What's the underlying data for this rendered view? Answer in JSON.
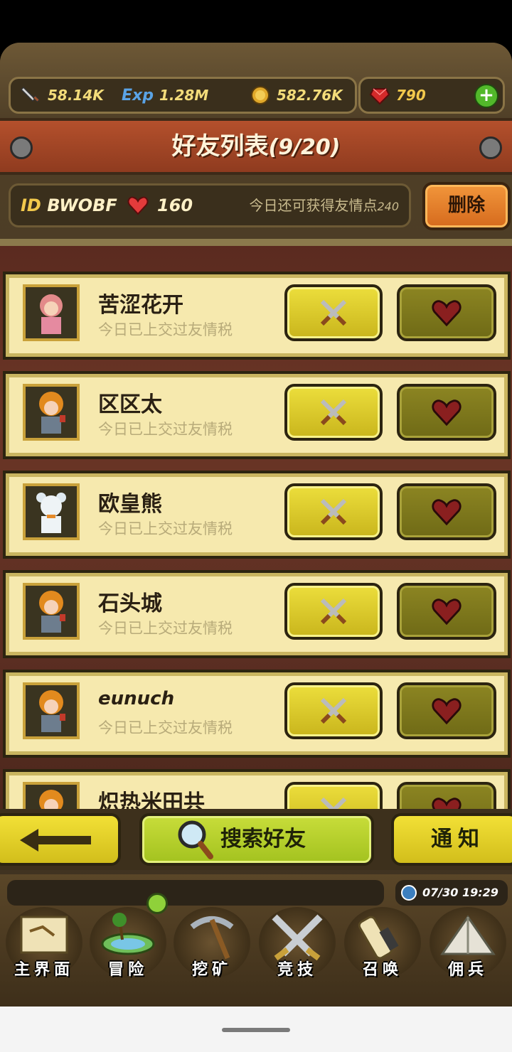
{
  "currency": {
    "attack": "58.14K",
    "exp_label": "Exp",
    "exp": "1.28M",
    "gold": "582.76K",
    "gems": "790",
    "add_label": "+"
  },
  "title": {
    "main": "好友列表",
    "count": "(9/20)"
  },
  "info": {
    "id_label": "ID",
    "id_value": "BWOBF",
    "hearts": "160",
    "today_text": "今日还可获得友情点",
    "today_value": "240",
    "delete_label": "删除"
  },
  "friends": [
    {
      "name": "苦涩花开",
      "status": "今日已上交过友情税",
      "avatar": "pink-girl-avatar"
    },
    {
      "name": "区区太",
      "status": "今日已上交过友情税",
      "avatar": "orange-hair-knight-avatar"
    },
    {
      "name": "欧皇熊",
      "status": "今日已上交过友情税",
      "avatar": "white-bear-avatar"
    },
    {
      "name": "石头城",
      "status": "今日已上交过友情税",
      "avatar": "orange-hair-knight-avatar"
    },
    {
      "name": "eunuch",
      "status": "今日已上交过友情税",
      "avatar": "orange-hair-knight-avatar"
    },
    {
      "name": "炽热米田共",
      "status": "",
      "avatar": "orange-hair-knight-avatar"
    }
  ],
  "actions": {
    "search_label": "搜索好友",
    "notify_label": "通知"
  },
  "clock": "07/30 19:29",
  "nav": [
    {
      "label": "主界面",
      "icon": "scroll-map-icon"
    },
    {
      "label": "冒险",
      "icon": "island-icon"
    },
    {
      "label": "挖矿",
      "icon": "pickaxe-icon"
    },
    {
      "label": "竞技",
      "icon": "crossed-swords-icon"
    },
    {
      "label": "召唤",
      "icon": "summon-scroll-icon"
    },
    {
      "label": "佣兵",
      "icon": "tent-icon"
    }
  ],
  "colors": {
    "accent": "#f2c94c",
    "banner": "#a8462a",
    "row": "#f6e9ae"
  }
}
